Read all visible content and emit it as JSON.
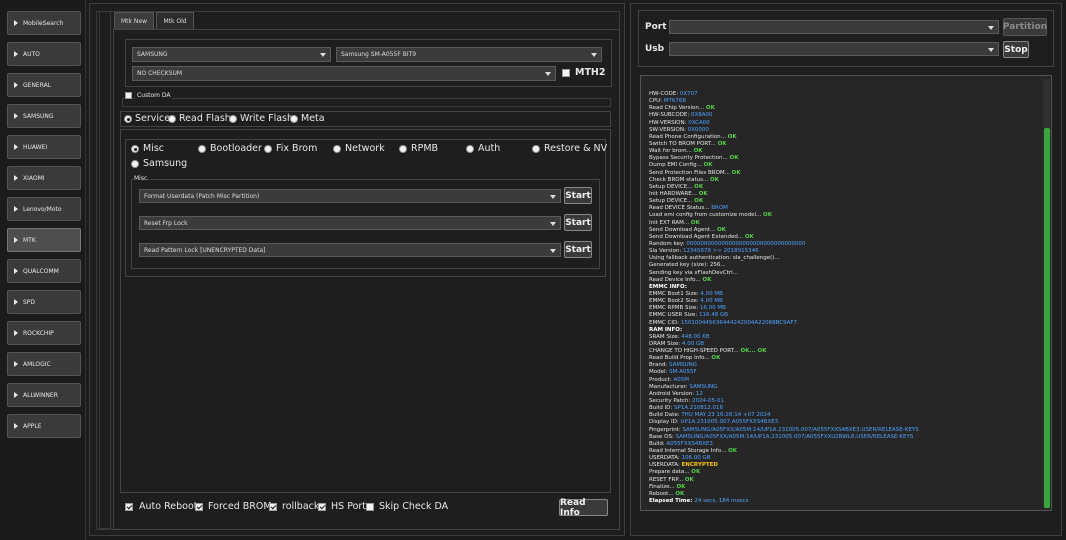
{
  "sidebar": {
    "items": [
      {
        "label": "MobileSearch"
      },
      {
        "label": "AUTO"
      },
      {
        "label": "GENERAL"
      },
      {
        "label": "SAMSUNG"
      },
      {
        "label": "HUAWEI"
      },
      {
        "label": "XIAOMI"
      },
      {
        "label": "Lenovo/Moto"
      },
      {
        "label": "MTK"
      },
      {
        "label": "QUALCOMM"
      },
      {
        "label": "SPD"
      },
      {
        "label": "ROCKCHIP"
      },
      {
        "label": "AMLOGIC"
      },
      {
        "label": "ALLWINNER"
      },
      {
        "label": "APPLE"
      }
    ],
    "active": "MTK"
  },
  "tabs": [
    {
      "label": "Mtk New"
    },
    {
      "label": "Mtk Old"
    }
  ],
  "device": {
    "brand": "SAMSUNG",
    "model": "Samsung SM-A055F BIT9",
    "checksum": "NO CHECKSUM",
    "mth2_label": "MTH2",
    "custom_da_label": "Custom DA"
  },
  "modes": [
    "Service",
    "Read Flash",
    "Write Flash",
    "Meta"
  ],
  "categories": [
    "Misc",
    "Bootloader",
    "Fix Brom",
    "Network",
    "RPMB",
    "Auth",
    "Restore & NV",
    "Samsung"
  ],
  "misc": {
    "group_label": "Misc.",
    "start_label": "Start",
    "ops": [
      "Format Userdata (Patch Misc Partition)",
      "Reset Frp Lock",
      "Read Pattern Lock [UNENCRYPTED Data]"
    ]
  },
  "options": {
    "auto_reboot": "Auto Reboot",
    "forced_brom": "Forced BROM",
    "rollback": "rollback",
    "hs_port": "HS Port",
    "skip_check_da": "Skip Check DA",
    "read_info": "Read Info"
  },
  "port": {
    "port_label": "Port",
    "usb_label": "Usb",
    "partition_label": "Partition",
    "stop_label": "Stop"
  },
  "log": [
    {
      "k": "HW-CODE: ",
      "v": "0X707",
      "c": "v"
    },
    {
      "k": "CPU: ",
      "v": "MT6768",
      "c": "v"
    },
    {
      "k": "Read Chip Version... ",
      "v": "OK",
      "c": "ok"
    },
    {
      "k": "HW-SUBCODE: ",
      "v": "0X8A00",
      "c": "v"
    },
    {
      "k": "HW-VERSION: ",
      "v": "0XCA00",
      "c": "v"
    },
    {
      "k": "SW-VERSION: ",
      "v": "0X0000",
      "c": "v"
    },
    {
      "k": "Read Phone Configuration... ",
      "v": "OK",
      "c": "ok"
    },
    {
      "k": "Switch TO BROM PORT... ",
      "v": "OK",
      "c": "ok"
    },
    {
      "k": "Wait for brom... ",
      "v": "OK",
      "c": "ok"
    },
    {
      "k": "Bypass Security Protection... ",
      "v": "OK",
      "c": "ok"
    },
    {
      "k": "Dump EMI Config... ",
      "v": "OK",
      "c": "ok"
    },
    {
      "k": "Send Protection Files BROM... ",
      "v": "OK",
      "c": "ok"
    },
    {
      "k": "Check BROM status... ",
      "v": "OK",
      "c": "ok"
    },
    {
      "k": "Setup DEVICE... ",
      "v": "OK",
      "c": "ok"
    },
    {
      "k": "Init HARDWARE... ",
      "v": "OK",
      "c": "ok"
    },
    {
      "k": "Setup DEVICE... ",
      "v": "OK",
      "c": "ok"
    },
    {
      "k": "Read DEVICE Status... ",
      "v": "BROM",
      "c": "v"
    },
    {
      "k": "Load emi config from customize model... ",
      "v": "OK",
      "c": "ok"
    },
    {
      "k": "Init EXT RAM... ",
      "v": "OK",
      "c": "ok"
    },
    {
      "k": "Send Download Agent... ",
      "v": "OK",
      "c": "ok"
    },
    {
      "k": "Send Download Agent Extended... ",
      "v": "OK",
      "c": "ok"
    },
    {
      "k": "Random key: ",
      "v": "0000000000000000000000000000000000",
      "c": "v"
    },
    {
      "k": "Sla Version: ",
      "v": "12345678 >> 2018915346",
      "c": "v"
    },
    {
      "k": "Using fallback authentication: sla_challenge()...",
      "v": "",
      "c": "v"
    },
    {
      "k": "Generated key (size): 256...",
      "v": "",
      "c": "v"
    },
    {
      "k": "Sending key via xFlashDevCtrl...",
      "v": "",
      "c": "v"
    },
    {
      "k": "Read Device Info... ",
      "v": "OK",
      "c": "ok"
    },
    {
      "k": "EMMC INFO:",
      "v": "",
      "c": "b"
    },
    {
      "k": "EMMC Boot1 Size: ",
      "v": "4.00 MB",
      "c": "v"
    },
    {
      "k": "EMMC Boot2 Size: ",
      "v": "4.00 MB",
      "c": "v"
    },
    {
      "k": "EMMC RPMB Size: ",
      "v": "16.00 MB",
      "c": "v"
    },
    {
      "k": "EMMC USER Size: ",
      "v": "116.48 GB",
      "c": "v"
    },
    {
      "k": "EMMC CID: ",
      "v": "150100445636444242004A22068BC9AF7",
      "c": "v"
    },
    {
      "k": "RAM INFO:",
      "v": "",
      "c": "b"
    },
    {
      "k": "SRAM Size: ",
      "v": "448.00 KB",
      "c": "v"
    },
    {
      "k": "DRAM Size: ",
      "v": "4.00 GB",
      "c": "v"
    },
    {
      "k": "CHANGE TO HIGH-SPEED PORT... ",
      "v": "OK... OK",
      "c": "ok"
    },
    {
      "k": "Read Build Prop Info... ",
      "v": "OK",
      "c": "ok"
    },
    {
      "k": " Brand: ",
      "v": "SAMSUNG",
      "c": "v"
    },
    {
      "k": " Model: ",
      "v": "SM-A055F",
      "c": "v"
    },
    {
      "k": " Product: ",
      "v": "A05M",
      "c": "v"
    },
    {
      "k": " Manufacturer: ",
      "v": "SAMSUNG",
      "c": "v"
    },
    {
      "k": " Android Version: ",
      "v": "12",
      "c": "v"
    },
    {
      "k": " Security Patch: ",
      "v": "2024-05-01",
      "c": "v"
    },
    {
      "k": " Build ID: ",
      "v": "SP1A.210812.016",
      "c": "v"
    },
    {
      "k": " Build Date: ",
      "v": "THU MAY 23 16:26:14 +07 2024",
      "c": "v"
    },
    {
      "k": " Display ID: ",
      "v": "UP1A.231005.007.A055FXXS4BXE3",
      "c": "v"
    },
    {
      "k": " Fingerprint: ",
      "v": "SAMSUNG/A05FXX/A05M:14/UP1A.231005.007/A055FXXS4BXE3:USER/RELEASE-KEYS",
      "c": "v"
    },
    {
      "k": " Base OS: ",
      "v": "SAMSUNG/A05FXX/A05M:14/UP1A.231005.007/A055FXXU2BWL6:USER/RELEASE-KEYS",
      "c": "v"
    },
    {
      "k": " Build: ",
      "v": "A055FXXS4BXE3",
      "c": "v"
    },
    {
      "k": "Read Internal Storage Info... ",
      "v": "OK",
      "c": "ok"
    },
    {
      "k": "USERDATA: ",
      "v": "106.00 GB",
      "c": "v"
    },
    {
      "k": "USERDATA: ",
      "v": "ENCRYPTED",
      "c": "warn"
    },
    {
      "k": "Prepare data... ",
      "v": "OK",
      "c": "ok"
    },
    {
      "k": "RESET FRP... ",
      "v": "OK",
      "c": "ok"
    },
    {
      "k": "Finalize... ",
      "v": "OK",
      "c": "ok"
    },
    {
      "k": "Reboot... ",
      "v": "OK",
      "c": "ok"
    },
    {
      "k": "Elapsed Time: ",
      "v": "24 secs, 184 msecs",
      "c": "v",
      "bold": true
    }
  ],
  "colors": {
    "ok": "#56d24a",
    "value": "#4fa3ff",
    "warn": "#ffc200",
    "scroll_thumb": "#38a83a"
  }
}
